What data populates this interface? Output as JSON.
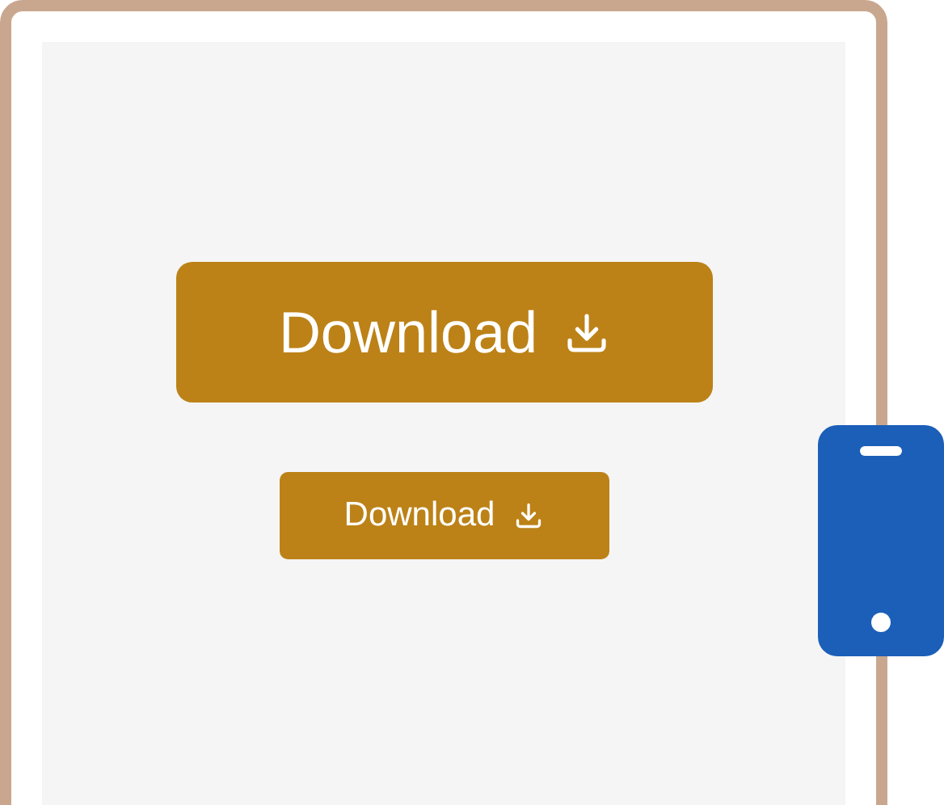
{
  "buttons": [
    {
      "label": "Download",
      "kind": "large"
    },
    {
      "label": "Download",
      "kind": "small"
    }
  ]
}
